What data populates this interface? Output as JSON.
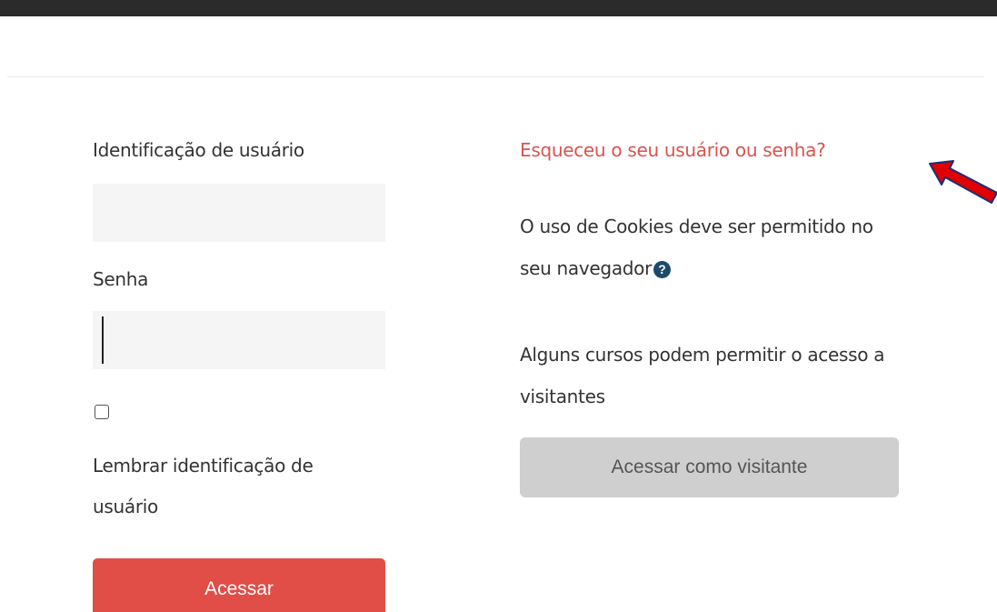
{
  "login_form": {
    "username_label": "Identificação de usuário",
    "username_value": "",
    "password_label": "Senha",
    "password_value": "",
    "remember_checked": false,
    "remember_label": "Lembrar identificação de usuário",
    "submit_label": "Acessar"
  },
  "side_panel": {
    "forgot_link": "Esqueceu o seu usuário ou senha?",
    "cookies_text": "O uso de Cookies deve ser permitido no seu navegador",
    "help_icon_glyph": "?",
    "guests_text": "Alguns cursos podem permitir o acesso a visitantes",
    "guest_button_label": "Acessar como visitante"
  },
  "colors": {
    "primary_button": "#e04e47",
    "link": "#d9534f",
    "guest_button": "#cfcfcf",
    "annotation_arrow": "#e00000",
    "top_bar": "#2b2b2b"
  },
  "icons": {
    "help": "question-circle-icon",
    "annotation": "red-arrow-annotation"
  }
}
